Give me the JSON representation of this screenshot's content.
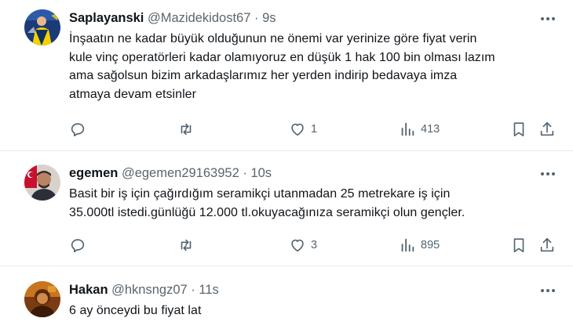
{
  "tweets": [
    {
      "name": "Saplayanski",
      "handle": "@Mazidekidost67",
      "separator": "·",
      "time": "9s",
      "lines": [
        "İnşaatın ne kadar büyük olduğunun ne önemi var yerinize göre fiyat verin",
        "kule vinç operatörleri kadar olamıyoruz en düşük 1 hak 100 bin olması lazım",
        "ama sağolsun bizim arkadaşlarımız her yerden indirip bedavaya imza",
        "atmaya devam etsinler"
      ],
      "likes": "1",
      "views": "413",
      "avatar_icon": "football-player-avatar"
    },
    {
      "name": "egemen",
      "handle": "@egemen29163952",
      "separator": "·",
      "time": "10s",
      "lines": [
        "Basit bir iş için çağırdığım seramikçi utanmadan 25 metrekare iş için",
        "35.000tl istedi.günlüğü 12.000 tl.okuyacağınıza seramikçi olun gençler."
      ],
      "likes": "3",
      "views": "895",
      "avatar_icon": "man-with-flag-avatar"
    },
    {
      "name": "Hakan",
      "handle": "@hknsngz07",
      "separator": "·",
      "time": "11s",
      "lines": [
        "6 ay önceydi bu fiyat lat"
      ],
      "avatar_icon": "orange-portrait-avatar"
    }
  ],
  "colors": {
    "text": "#0f1419",
    "secondary": "#59656f",
    "icon": "#536471",
    "divider": "#e6e9eb"
  },
  "icons": [
    "reply-icon",
    "retweet-icon",
    "like-icon",
    "views-icon",
    "bookmark-icon",
    "share-icon",
    "more-icon"
  ]
}
